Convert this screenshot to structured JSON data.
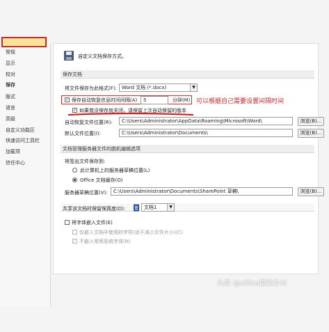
{
  "sidebar": {
    "items": [
      {
        "label": "常规"
      },
      {
        "label": "显示"
      },
      {
        "label": "校对"
      },
      {
        "label": "保存"
      },
      {
        "label": "版式"
      },
      {
        "label": "语言"
      },
      {
        "label": "高级"
      },
      {
        "label": "自定义功能区"
      },
      {
        "label": "快速访问工具栏"
      },
      {
        "label": "加载项"
      },
      {
        "label": "信任中心"
      }
    ],
    "selected": "保存"
  },
  "header": {
    "title": "自定义文档保存方式。",
    "icon": "floppy-disk-icon"
  },
  "save_documents": {
    "heading": "保存文档",
    "format_label": "将文件保存为此格式(F):",
    "format_value": "Word 文档 (*.docx)",
    "autorecover_label": "保存自动恢复信息时间间隔(A)",
    "autorecover_checked": true,
    "autorecover_minutes": "5",
    "minutes_unit": "分钟(M)",
    "keep_last_label": "如果我没保存就关闭，请保留上次自动保留的版本",
    "keep_last_checked": true,
    "autorecover_path_label": "自动恢复文件位置(R):",
    "autorecover_path": "C:\\Users\\Administrator\\AppData\\Roaming\\Microsoft\\Word\\",
    "default_path_label": "默认文件位置(I):",
    "default_path": "C:\\Users\\Administrator\\Documents\\",
    "browse1": "浏览(B)...",
    "browse2": "浏览(B)..."
  },
  "annotation": "可以根据自己需要设置间隔时间",
  "offline": {
    "heading": "文档管理服务器文件的脱机编辑选项",
    "save_to_label": "将签出文件保存到:",
    "opt_server": "此计算机上的服务器草稿位置(L)",
    "opt_server_selected": false,
    "opt_office": "Office 文档缓存(O)",
    "opt_office_selected": true,
    "drafts_label": "服务器草稿位置(V):",
    "drafts_path": "C:\\Users\\Administrator\\Documents\\SharePoint 草稿\\",
    "browse3": "浏览(B)..."
  },
  "fidelity": {
    "heading": "共享该文档时保留保真度(D):",
    "doc_value": "文档1",
    "embed_fonts": "将字体嵌入文件(E)",
    "embed_fonts_checked": false,
    "embed_used_only": "仅嵌入文档中使用的字符(适于减小文件大小)(C)",
    "no_common_fonts": "不嵌入常用系统字体(N)"
  },
  "watermark": "头条 @office精彩办公",
  "colors": {
    "accent_red": "#c42a2a",
    "selected_bg": "#fbe29a"
  }
}
